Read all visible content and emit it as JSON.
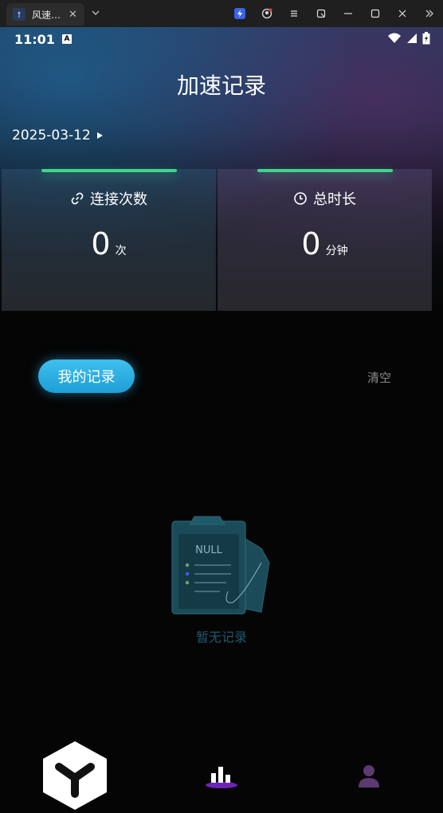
{
  "window": {
    "tab_title": "风速…",
    "tab_close": "✕",
    "icons": [
      "app-icon",
      "chevron-down-icon",
      "bolt-icon",
      "account-icon",
      "menu-icon",
      "screenshot-icon",
      "minimize-icon",
      "maximize-icon",
      "close-icon",
      "more-icon"
    ]
  },
  "status_bar": {
    "time": "11:01",
    "indicator": "A",
    "icons": [
      "wifi-icon",
      "signal-icon",
      "battery-icon"
    ]
  },
  "page": {
    "title": "加速记录",
    "date": "2025-03-12"
  },
  "stats": {
    "connections": {
      "label": "连接次数",
      "value": "0",
      "unit": "次",
      "icon": "link-icon"
    },
    "duration": {
      "label": "总时长",
      "value": "0",
      "unit": "分钟",
      "icon": "clock-icon"
    },
    "accent_color": "#3fd58a"
  },
  "records": {
    "tab_label": "我的记录",
    "clear_label": "清空",
    "empty_badge": "NULL",
    "empty_text": "暂无记录"
  },
  "nav": {
    "items": [
      "logo-icon",
      "stats-icon",
      "profile-icon"
    ],
    "active_color": "#8a2be2"
  }
}
